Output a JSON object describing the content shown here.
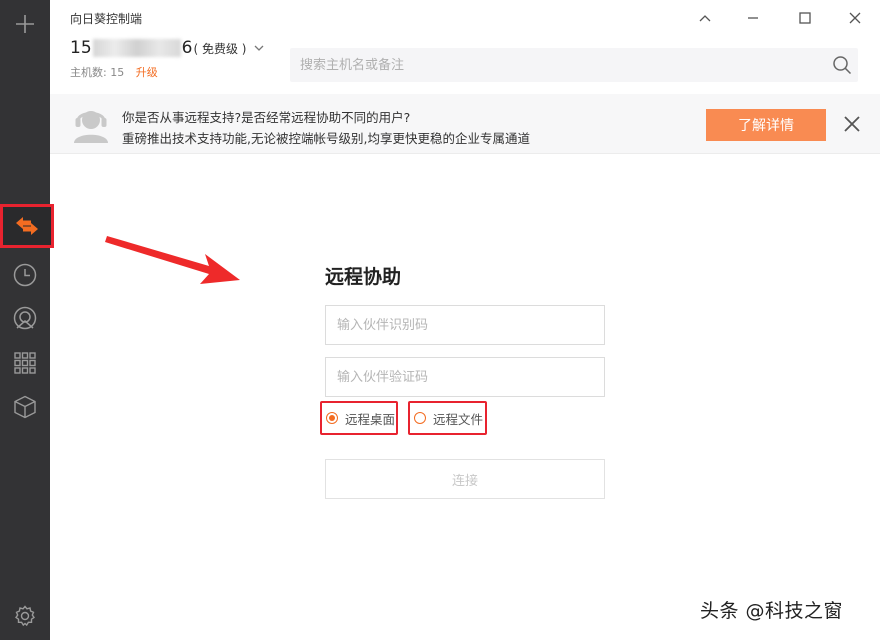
{
  "window": {
    "title": "向日葵控制端"
  },
  "account": {
    "number_prefix": "15",
    "number_suffix": "6",
    "tier": "( 免费级 )",
    "host_count_label": "主机数:",
    "host_count": "15",
    "upgrade_label": "升级"
  },
  "search": {
    "placeholder": "搜索主机名或备注"
  },
  "banner": {
    "line1": "你是否从事远程支持?是否经常远程协助不同的用户?",
    "line2": "重磅推出技术支持功能,无论被控端帐号级别,均享更快更稳的企业专属通道",
    "button_label": "了解详情"
  },
  "sidebar": {
    "items": [
      {
        "icon": "plus-icon"
      },
      {
        "icon": "remote-assist-icon",
        "active": true
      },
      {
        "icon": "clock-icon"
      },
      {
        "icon": "discover-icon"
      },
      {
        "icon": "grid-apps-icon"
      },
      {
        "icon": "cube-icon"
      },
      {
        "icon": "gear-icon"
      }
    ]
  },
  "main": {
    "heading": "远程协助",
    "partner_id_placeholder": "输入伙伴识别码",
    "partner_code_placeholder": "输入伙伴验证码",
    "options": [
      {
        "label": "远程桌面",
        "selected": true
      },
      {
        "label": "远程文件",
        "selected": false
      }
    ],
    "connect_label": "连接"
  },
  "watermark": "头条 @科技之窗",
  "colors": {
    "accent": "#f36c21",
    "highlight": "#e8232f",
    "rail": "#333335",
    "button": "#f98b52"
  }
}
